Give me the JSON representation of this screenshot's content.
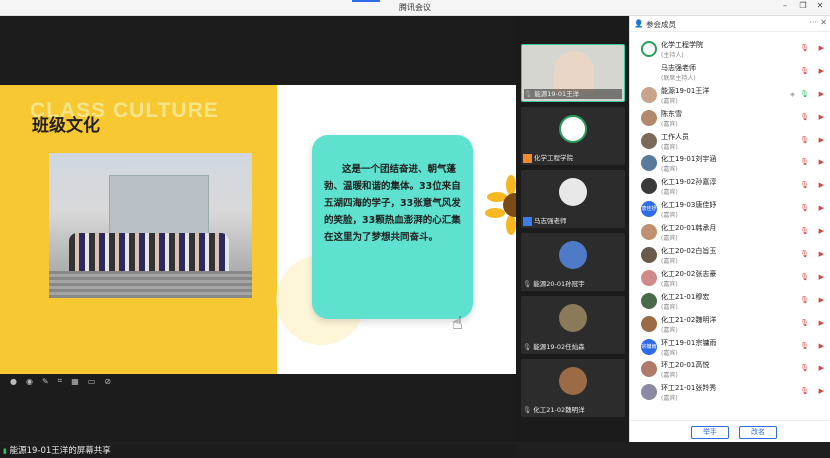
{
  "window": {
    "title": "腾讯会议",
    "controls": {
      "minimize": "–",
      "restore": "❐",
      "close": "✕"
    }
  },
  "slide": {
    "faded_title": "CLASS CULTURE",
    "title": "班级文化",
    "paragraph": "这是一个团结奋进、朝气蓬勃、温暖和谐的集体。33位来自五湖四海的学子，33张意气风发的笑脸，33颗热血澎湃的心汇集在这里为了梦想共同奋斗。"
  },
  "share_status": {
    "text": "能源19-01王洋的屏幕共享"
  },
  "video_tiles": [
    {
      "name": "能源19-01王洋",
      "type": "self"
    },
    {
      "name": "化学工程学院",
      "type": "host"
    },
    {
      "name": "马志强老师",
      "type": "user"
    },
    {
      "name": "能源20-01孙冠宇",
      "type": "normal"
    },
    {
      "name": "能源19-02任灿森",
      "type": "normal"
    },
    {
      "name": "化工21-02魏明洋",
      "type": "normal"
    }
  ],
  "participants_panel": {
    "title": "参会成员",
    "more": "···",
    "close": "✕",
    "members": [
      {
        "name": "化学工程学院",
        "role": "(主持人)",
        "avatar": "logo"
      },
      {
        "name": "马志强老师",
        "role": "(联席主持人)",
        "avatar": "none"
      },
      {
        "name": "能源19-01王洋",
        "role": "(嘉宾)",
        "avatar": "photo",
        "mic_on": true
      },
      {
        "name": "陈东雪",
        "role": "(嘉宾)",
        "avatar": "photo"
      },
      {
        "name": "工作人员",
        "role": "(嘉宾)",
        "avatar": "photo"
      },
      {
        "name": "化工19-01刘宇涵",
        "role": "(嘉宾)",
        "avatar": "photo"
      },
      {
        "name": "化工19-02孙嘉淳",
        "role": "(嘉宾)",
        "avatar": "photo"
      },
      {
        "name": "化工19-03唐佳妤",
        "role": "(嘉宾)",
        "avatar": "blue",
        "avatar_text": "唐佳妤"
      },
      {
        "name": "化工20-01韩承月",
        "role": "(嘉宾)",
        "avatar": "photo"
      },
      {
        "name": "化工20-02白旨玉",
        "role": "(嘉宾)",
        "avatar": "photo"
      },
      {
        "name": "化工20-02张志豪",
        "role": "(嘉宾)",
        "avatar": "photo"
      },
      {
        "name": "化工21-01穆宏",
        "role": "(嘉宾)",
        "avatar": "photo"
      },
      {
        "name": "化工21-02魏明洋",
        "role": "(嘉宾)",
        "avatar": "photo"
      },
      {
        "name": "环工19-01宗镛雨",
        "role": "(嘉宾)",
        "avatar": "blue",
        "avatar_text": "宗镛雨"
      },
      {
        "name": "环工20-01高悦",
        "role": "(嘉宾)",
        "avatar": "photo"
      },
      {
        "name": "环工21-01张羚秀",
        "role": "(嘉宾)",
        "avatar": "photo"
      }
    ],
    "buttons": {
      "raise_hand": "举手",
      "rename": "改名"
    }
  },
  "colors": {
    "accent": "#2e6be6",
    "slide_yellow": "#f8c832",
    "card_teal": "#5ee2cf",
    "mute_red": "#d64545"
  },
  "icons": {
    "muted_mic": "mic-off-icon",
    "camera_off": "camera-off-icon",
    "mic_on": "mic-on-icon"
  }
}
